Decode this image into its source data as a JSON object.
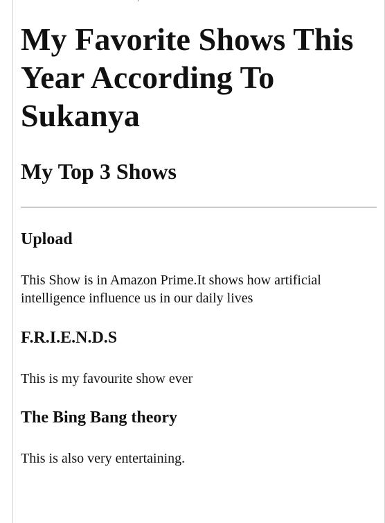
{
  "page": {
    "title": "My Favorite Shows This Year According To Sukanya",
    "subtitle": "My Top 3 Shows"
  },
  "shows": [
    {
      "name": "Upload",
      "description": "This Show is in Amazon Prime.It shows how artificial intelligence influence us in our daily lives"
    },
    {
      "name": "F.R.I.E.N.D.S",
      "description": "This is my favourite show ever"
    },
    {
      "name": "The Bing Bang theory",
      "description": "This is also very entertaining."
    }
  ]
}
